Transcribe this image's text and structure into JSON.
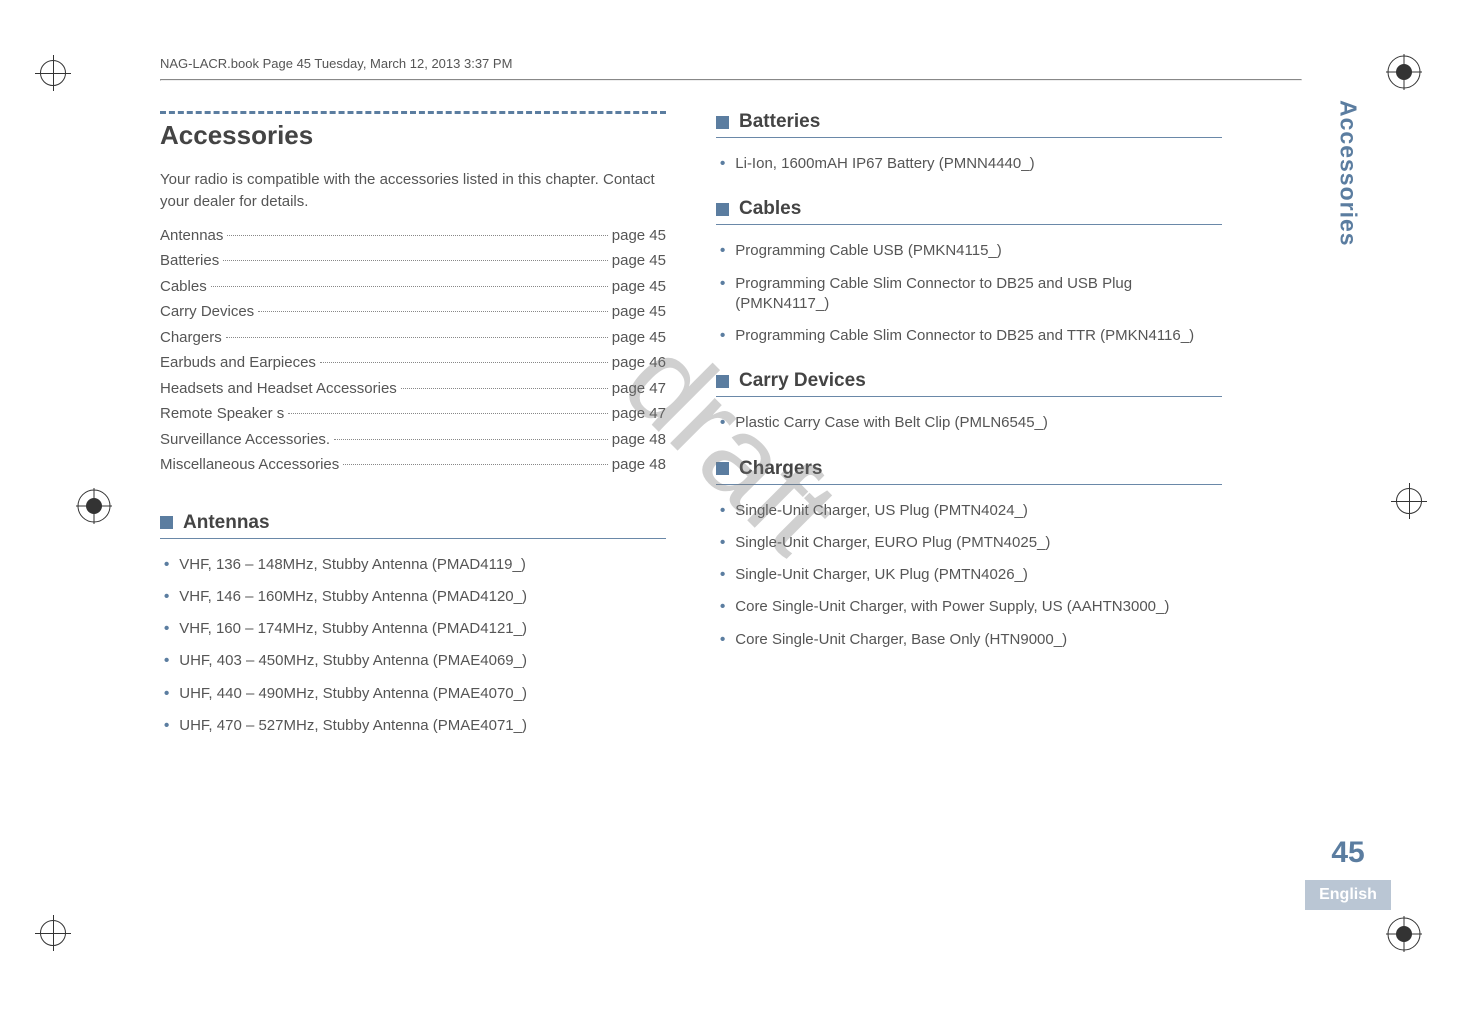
{
  "header_note": "NAG-LACR.book  Page 45  Tuesday, March 12, 2013  3:37 PM",
  "watermark": "draft",
  "side": {
    "label": "Accessories",
    "page_num": "45",
    "language": "English"
  },
  "title": "Accessories",
  "intro": "Your radio is compatible with the accessories listed in this chapter. Contact your dealer for details.",
  "toc": [
    {
      "label": "Antennas",
      "page": "page 45"
    },
    {
      "label": "Batteries",
      "page": "page 45"
    },
    {
      "label": "Cables",
      "page": "page 45"
    },
    {
      "label": "Carry Devices",
      "page": "page 45"
    },
    {
      "label": "Chargers",
      "page": "page 45"
    },
    {
      "label": "Earbuds and Earpieces",
      "page": "page 46"
    },
    {
      "label": "Headsets and Headset Accessories",
      "page": "page 47"
    },
    {
      "label": "Remote Speaker s",
      "page": "page 47"
    },
    {
      "label": "Surveillance Accessories.",
      "page": "page 48"
    },
    {
      "label": "Miscellaneous Accessories",
      "page": "page 48"
    }
  ],
  "sections": {
    "antennas": {
      "title": "Antennas",
      "items": [
        "VHF, 136 – 148MHz, Stubby Antenna (PMAD4119_)",
        "VHF, 146 – 160MHz, Stubby Antenna (PMAD4120_)",
        "VHF, 160 – 174MHz, Stubby Antenna (PMAD4121_)",
        "UHF, 403 – 450MHz, Stubby Antenna (PMAE4069_)",
        "UHF, 440 – 490MHz, Stubby Antenna (PMAE4070_)",
        "UHF, 470 – 527MHz, Stubby Antenna (PMAE4071_)"
      ]
    },
    "batteries": {
      "title": "Batteries",
      "items": [
        "Li-Ion, 1600mAH IP67 Battery (PMNN4440_)"
      ]
    },
    "cables": {
      "title": "Cables",
      "items": [
        "Programming Cable USB (PMKN4115_)",
        "Programming Cable Slim Connector to DB25 and USB Plug (PMKN4117_)",
        "Programming Cable Slim Connector to DB25 and TTR (PMKN4116_)"
      ]
    },
    "carry": {
      "title": "Carry Devices",
      "items": [
        "Plastic Carry Case with Belt Clip (PMLN6545_)"
      ]
    },
    "chargers": {
      "title": "Chargers",
      "items": [
        "Single-Unit Charger, US Plug (PMTN4024_)",
        "Single-Unit Charger, EURO Plug (PMTN4025_)",
        "Single-Unit Charger, UK Plug (PMTN4026_)",
        "Core Single-Unit Charger, with Power Supply, US (AAHTN3000_)",
        "Core Single-Unit Charger, Base Only (HTN9000_)"
      ]
    }
  }
}
